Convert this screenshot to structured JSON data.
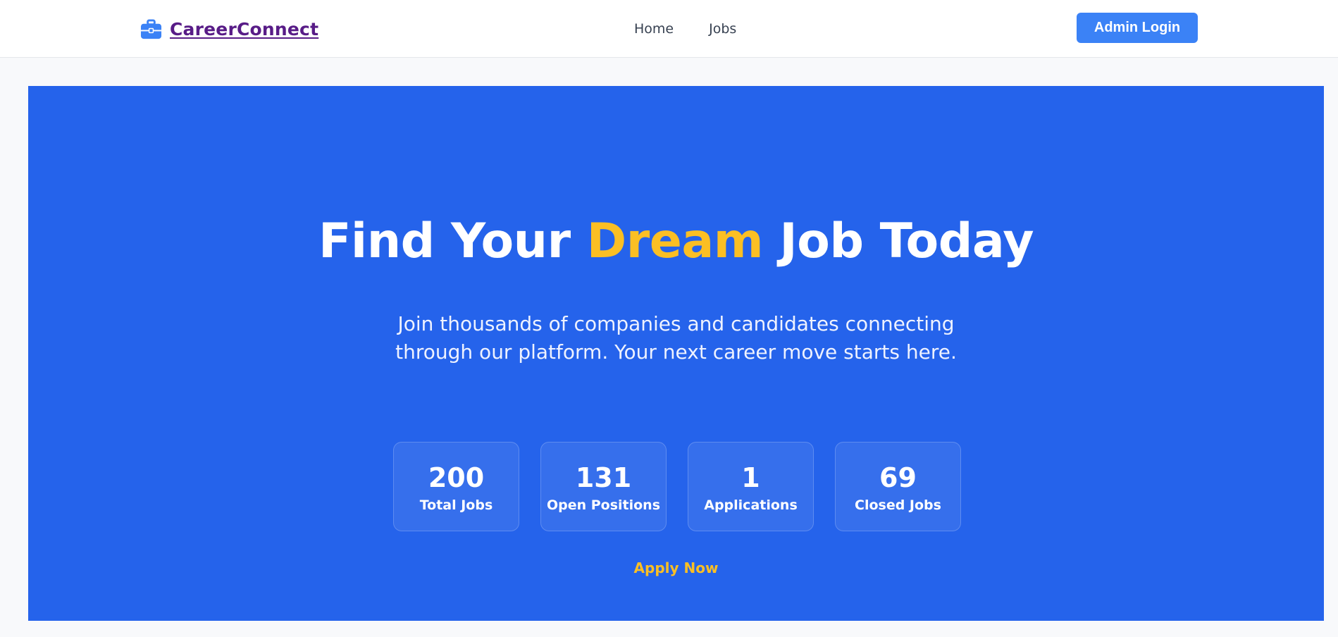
{
  "nav": {
    "brand": "CareerConnect",
    "brand_icon": "briefcase-icon",
    "links": [
      "Home",
      "Jobs"
    ],
    "admin_button": "Admin Login"
  },
  "hero": {
    "title_before": "Find Your ",
    "title_accent": "Dream",
    "title_after": " Job Today",
    "subtitle_line1": "Join thousands of companies and candidates connecting",
    "subtitle_line2": "through our platform. Your next career move starts here.",
    "stats": [
      {
        "value": "200",
        "label": "Total Jobs"
      },
      {
        "value": "131",
        "label": "Open Positions"
      },
      {
        "value": "1",
        "label": "Applications"
      },
      {
        "value": "69",
        "label": "Closed Jobs"
      }
    ],
    "cta": "Apply Now"
  },
  "colors": {
    "primary": "#2563eb",
    "accent": "#fbbf24",
    "brand_text": "#581c87",
    "button": "#3b82f6"
  }
}
